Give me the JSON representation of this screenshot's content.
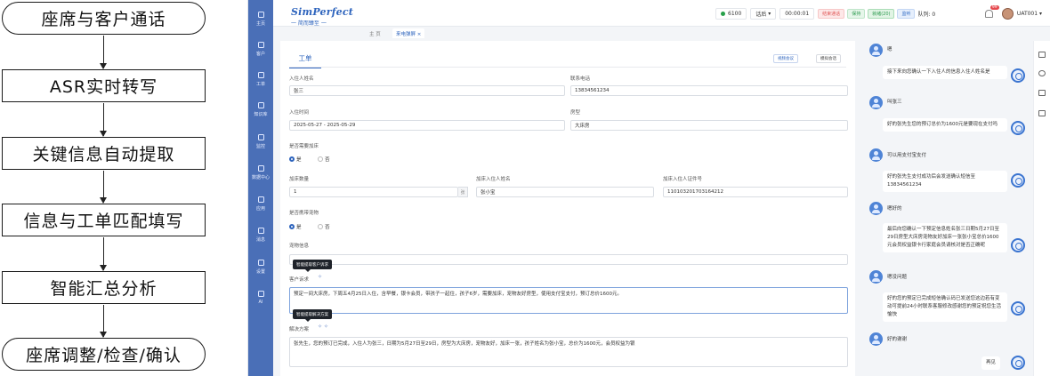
{
  "flow": {
    "steps": [
      "座席与客户通话",
      "ASR实时转写",
      "关键信息自动提取",
      "信息与工单匹配填写",
      "智能汇总分析",
      "座席调整/检查/确认"
    ]
  },
  "app": {
    "logo": "SimPerfect",
    "logo_sub": "一 简而臻至 一",
    "sidebar": [
      "主页",
      "客户",
      "工单",
      "知识库",
      "监控",
      "数据中心",
      "应用",
      "消息",
      "设置",
      "AI"
    ],
    "status": {
      "extension": "6100",
      "call_state": "话后",
      "call_timer": "00:00:01",
      "btn_hangup": "结束通话",
      "btn_hold": "保持",
      "btn_idle": "就绪(20)",
      "btn_monitor": "监听",
      "queue": "队列: 0",
      "notify_count": "99",
      "user": "UAT001"
    },
    "tabs": [
      "主 页",
      "来电弹屏 ×"
    ],
    "panel": {
      "tab": "工单",
      "btn_video": "视频会议",
      "btn_simulate": "模拟会话",
      "name_label": "入住人姓名",
      "name_value": "张三",
      "phone_label": "联系电话",
      "phone_value": "13834561234",
      "date_label": "入住时间",
      "date_value": "2025-05-27 - 2025-05-29",
      "room_label": "房型",
      "room_value": "大床房",
      "extra_bed_label": "是否需要加床",
      "yes": "是",
      "no": "否",
      "bed_count_label": "加床数量",
      "bed_count_value": "1",
      "bed_unit": "张",
      "bed_name_label": "加床入住人姓名",
      "bed_name_value": "张小宝",
      "bed_id_label": "加床入住人证件号",
      "bed_id_value": "110103201703164212",
      "pet_label": "是否携带宠物",
      "pet_info_label": "宠物信息",
      "pet_info_value": "",
      "tip_request": "智能提取客户诉求",
      "request_label": "客户诉求",
      "request_value": "预定一间大床房，下周五4月25日入住，含早餐，银卡会员，带孩子一起住，孩子6岁，需要加床，宠物友好房型，使用支付宝支付，预订总价1600元。",
      "tip_solution": "智能提取解决方案",
      "solution_label": "解决方案",
      "solution_value": "张先生，您的预订已完成，入住人为张三，日期为5月27日至29日，房型为大床房，宠物友好，加床一张，孩子姓名为张小宝，总价为1600元，会员权益为银"
    },
    "chat": [
      {
        "from": "customer",
        "text": "嗯"
      },
      {
        "from": "agent",
        "text": "接下来向您确认一下入住人的信息入住人姓名是"
      },
      {
        "from": "customer",
        "text": "叫张三"
      },
      {
        "from": "agent",
        "text": "好的张先生您的预订总价为1600元是要现在支付吗"
      },
      {
        "from": "customer",
        "text": "可以用支付宝支付"
      },
      {
        "from": "agent",
        "text": "好的张先生支付成功后会发送确认短信至13834561234"
      },
      {
        "from": "customer",
        "text": "嗯好的"
      },
      {
        "from": "agent",
        "text": "最后向您确认一下预定信息姓名张三日期5月27日至29日房型大床房宠物友好加床一张张小宝总价1600元会员权益银卡行家庭会员请核对是否正确呢"
      },
      {
        "from": "customer",
        "text": "嗯没问题"
      },
      {
        "from": "agent",
        "text": "好的您的预定已完成短信确认码已发送您这边若有变动可提前24小时联系客服修改感谢您的预定祝您生活愉快"
      },
      {
        "from": "customer",
        "text": "好的谢谢"
      },
      {
        "from": "agent",
        "text": "再见"
      }
    ]
  }
}
